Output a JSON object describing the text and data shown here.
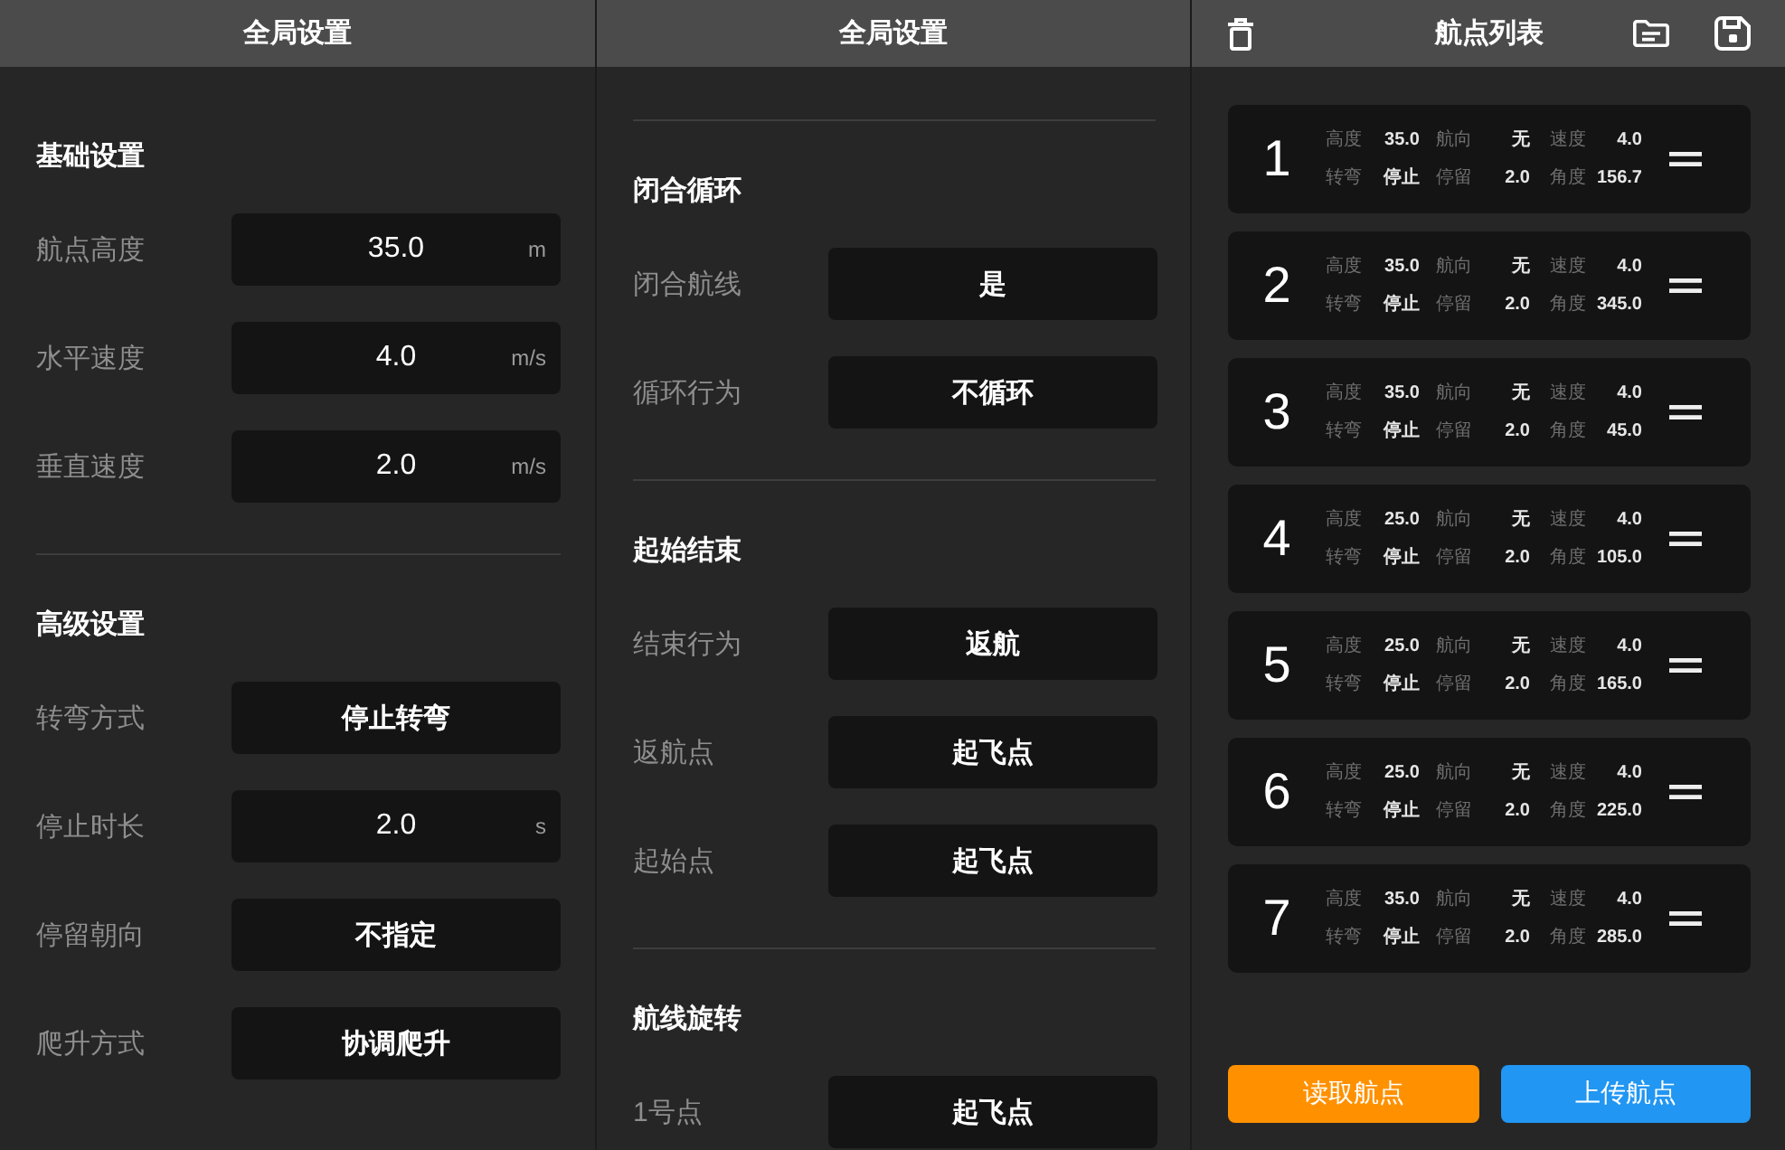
{
  "panels": [
    {
      "title": "全局设置",
      "sections": [
        {
          "title": "基础设置",
          "divider_above": false,
          "rows": [
            {
              "label": "航点高度",
              "kind": "number",
              "value": "35.0",
              "unit": "m"
            },
            {
              "label": "水平速度",
              "kind": "number",
              "value": "4.0",
              "unit": "m/s"
            },
            {
              "label": "垂直速度",
              "kind": "number",
              "value": "2.0",
              "unit": "m/s"
            }
          ]
        },
        {
          "title": "高级设置",
          "divider_above": true,
          "rows": [
            {
              "label": "转弯方式",
              "kind": "select",
              "value": "停止转弯"
            },
            {
              "label": "停止时长",
              "kind": "number",
              "value": "2.0",
              "unit": "s"
            },
            {
              "label": "停留朝向",
              "kind": "select",
              "value": "不指定"
            },
            {
              "label": "爬升方式",
              "kind": "select",
              "value": "协调爬升"
            }
          ]
        }
      ]
    },
    {
      "title": "全局设置",
      "sections": [
        {
          "title": "闭合循环",
          "divider_above": true,
          "rows": [
            {
              "label": "闭合航线",
              "kind": "select",
              "value": "是"
            },
            {
              "label": "循环行为",
              "kind": "select",
              "value": "不循环"
            }
          ]
        },
        {
          "title": "起始结束",
          "divider_above": true,
          "rows": [
            {
              "label": "结束行为",
              "kind": "select",
              "value": "返航"
            },
            {
              "label": "返航点",
              "kind": "select",
              "value": "起飞点"
            },
            {
              "label": "起始点",
              "kind": "select",
              "value": "起飞点"
            }
          ]
        },
        {
          "title": "航线旋转",
          "divider_above": true,
          "rows": [
            {
              "label": "1号点",
              "kind": "select",
              "value": "起飞点"
            }
          ]
        }
      ]
    }
  ],
  "waypoint_list": {
    "title": "航点列表",
    "waypoints": [
      {
        "number": "1",
        "fields": [
          {
            "label": "高度",
            "value": "35.0"
          },
          {
            "label": "航向",
            "value": "无"
          },
          {
            "label": "速度",
            "value": "4.0"
          },
          {
            "label": "转弯",
            "value": "停止"
          },
          {
            "label": "停留",
            "value": "2.0"
          },
          {
            "label": "角度",
            "value": "156.7"
          }
        ]
      },
      {
        "number": "2",
        "fields": [
          {
            "label": "高度",
            "value": "35.0"
          },
          {
            "label": "航向",
            "value": "无"
          },
          {
            "label": "速度",
            "value": "4.0"
          },
          {
            "label": "转弯",
            "value": "停止"
          },
          {
            "label": "停留",
            "value": "2.0"
          },
          {
            "label": "角度",
            "value": "345.0"
          }
        ]
      },
      {
        "number": "3",
        "fields": [
          {
            "label": "高度",
            "value": "35.0"
          },
          {
            "label": "航向",
            "value": "无"
          },
          {
            "label": "速度",
            "value": "4.0"
          },
          {
            "label": "转弯",
            "value": "停止"
          },
          {
            "label": "停留",
            "value": "2.0"
          },
          {
            "label": "角度",
            "value": "45.0"
          }
        ]
      },
      {
        "number": "4",
        "fields": [
          {
            "label": "高度",
            "value": "25.0"
          },
          {
            "label": "航向",
            "value": "无"
          },
          {
            "label": "速度",
            "value": "4.0"
          },
          {
            "label": "转弯",
            "value": "停止"
          },
          {
            "label": "停留",
            "value": "2.0"
          },
          {
            "label": "角度",
            "value": "105.0"
          }
        ]
      },
      {
        "number": "5",
        "fields": [
          {
            "label": "高度",
            "value": "25.0"
          },
          {
            "label": "航向",
            "value": "无"
          },
          {
            "label": "速度",
            "value": "4.0"
          },
          {
            "label": "转弯",
            "value": "停止"
          },
          {
            "label": "停留",
            "value": "2.0"
          },
          {
            "label": "角度",
            "value": "165.0"
          }
        ]
      },
      {
        "number": "6",
        "fields": [
          {
            "label": "高度",
            "value": "25.0"
          },
          {
            "label": "航向",
            "value": "无"
          },
          {
            "label": "速度",
            "value": "4.0"
          },
          {
            "label": "转弯",
            "value": "停止"
          },
          {
            "label": "停留",
            "value": "2.0"
          },
          {
            "label": "角度",
            "value": "225.0"
          }
        ]
      },
      {
        "number": "7",
        "fields": [
          {
            "label": "高度",
            "value": "35.0"
          },
          {
            "label": "航向",
            "value": "无"
          },
          {
            "label": "速度",
            "value": "4.0"
          },
          {
            "label": "转弯",
            "value": "停止"
          },
          {
            "label": "停留",
            "value": "2.0"
          },
          {
            "label": "角度",
            "value": "285.0"
          }
        ]
      }
    ],
    "buttons": [
      {
        "label": "读取航点",
        "color": "#ff9100"
      },
      {
        "label": "上传航点",
        "color": "#2196f3"
      }
    ]
  }
}
